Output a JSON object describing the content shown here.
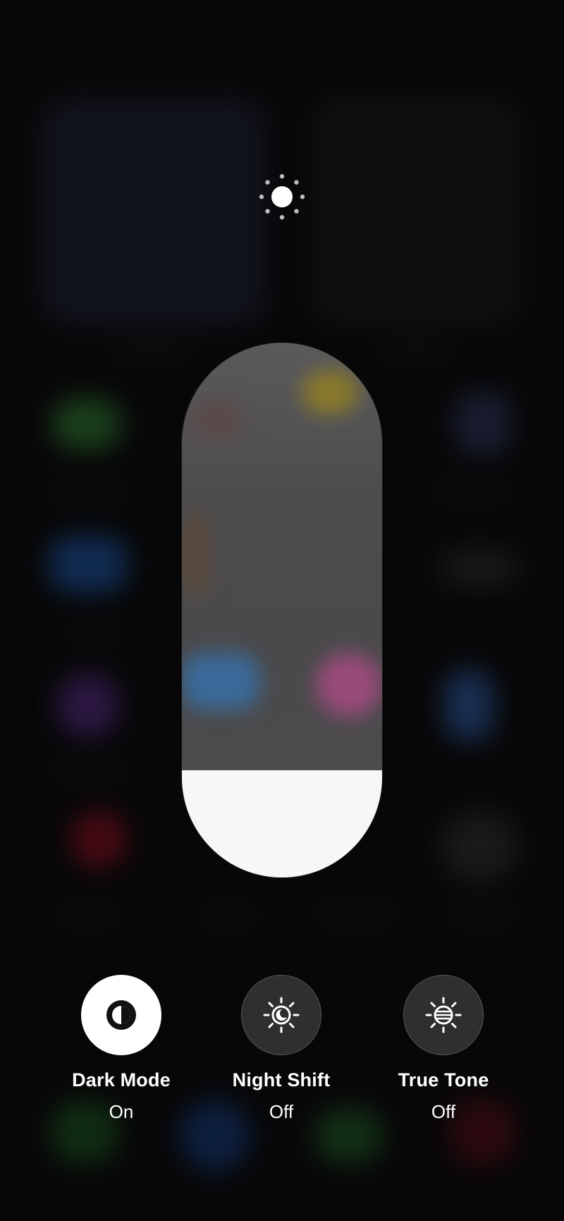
{
  "brightness": {
    "icon": "sun-icon",
    "level": 0.2
  },
  "toggles": [
    {
      "title": "Dark Mode",
      "status": "On",
      "icon": "dark-mode-icon",
      "active": true
    },
    {
      "title": "Night Shift",
      "status": "Off",
      "icon": "night-shift-icon",
      "active": false
    },
    {
      "title": "True Tone",
      "status": "Off",
      "icon": "true-tone-icon",
      "active": false
    }
  ],
  "colors": {
    "background": "#0c0c0d",
    "slider_track": "#4d4d4f",
    "slider_fill": "#f7f7f7",
    "toggle_on": "#ffffff",
    "toggle_off": "#2f2f31"
  }
}
